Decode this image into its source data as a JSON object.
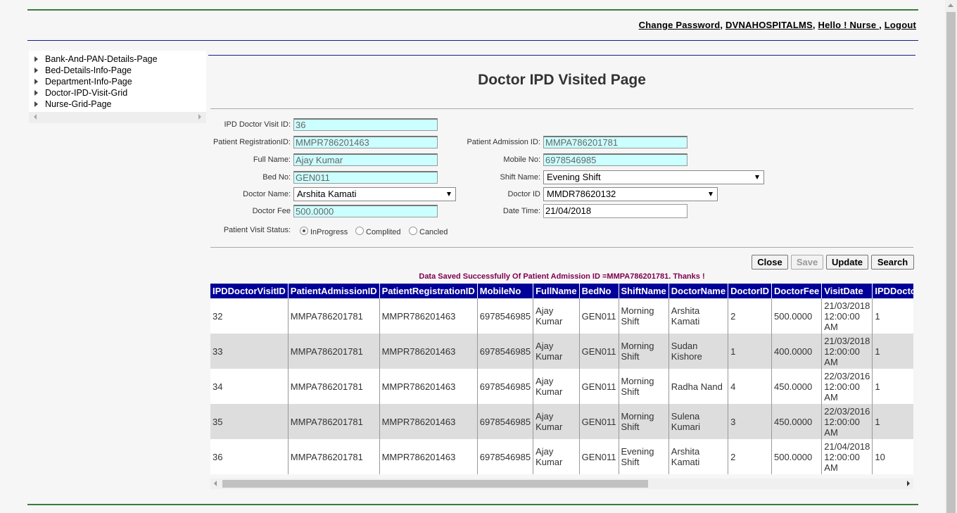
{
  "header": {
    "links": [
      "Change Password",
      "DVNAHOSPITALMS",
      "Hello ! Nurse ",
      "Logout"
    ]
  },
  "tree": {
    "items": [
      "Bank-And-PAN-Details-Page",
      "Bed-Details-Info-Page",
      "Department-Info-Page",
      "Doctor-IPD-Visit-Grid",
      "Nurse-Grid-Page"
    ]
  },
  "page_title": "Doctor IPD Visited Page",
  "form": {
    "ipd_doctor_visit_id": {
      "label": "IPD Doctor Visit ID:",
      "value": "36"
    },
    "patient_registration_id": {
      "label": "Patient RegistrationID:",
      "value": "MMPR786201463"
    },
    "patient_admission_id": {
      "label": "Patient Admission ID:",
      "value": "MMPA786201781"
    },
    "full_name": {
      "label": "Full Name:",
      "value": "Ajay Kumar"
    },
    "mobile_no": {
      "label": "Mobile No:",
      "value": "6978546985"
    },
    "bed_no": {
      "label": "Bed No:",
      "value": "GEN011"
    },
    "shift_name": {
      "label": "Shift Name:",
      "value": "Evening Shift"
    },
    "doctor_name": {
      "label": "Doctor Name:",
      "value": "Arshita Kamati"
    },
    "doctor_id": {
      "label": "Doctor ID",
      "value": "MMDR78620132"
    },
    "doctor_fee": {
      "label": "Doctor Fee",
      "value": "500.0000"
    },
    "date_time": {
      "label": "Date Time:",
      "value": "21/04/2018"
    },
    "visit_status": {
      "label": "Patient Visit Status:",
      "options": [
        "InProgress",
        "Complited",
        "Cancled"
      ],
      "selected": "InProgress"
    }
  },
  "buttons": {
    "close": "Close",
    "save": "Save",
    "update": "Update",
    "search": "Search"
  },
  "message": "Data Saved Successfully Of Patient Admission ID =MMPA786201781. Thanks !",
  "grid": {
    "columns": [
      "IPDDoctorVisitID",
      "PatientAdmissionID",
      "PatientRegistrationID",
      "MobileNo",
      "FullName",
      "BedNo",
      "ShiftName",
      "DoctorName",
      "DoctorID",
      "DoctorFee",
      "VisitDate",
      "IPDDoctorVisitStatus"
    ],
    "rows": [
      [
        "32",
        "MMPA786201781",
        "MMPR786201463",
        "6978546985",
        "Ajay Kumar",
        "GEN011",
        "Morning Shift",
        "Arshita Kamati",
        "2",
        "500.0000",
        "21/03/2018 12:00:00 AM",
        "1"
      ],
      [
        "33",
        "MMPA786201781",
        "MMPR786201463",
        "6978546985",
        "Ajay Kumar",
        "GEN011",
        "Morning Shift",
        "Sudan Kishore",
        "1",
        "400.0000",
        "21/03/2018 12:00:00 AM",
        "1"
      ],
      [
        "34",
        "MMPA786201781",
        "MMPR786201463",
        "6978546985",
        "Ajay Kumar",
        "GEN011",
        "Morning Shift",
        "Radha Nand",
        "4",
        "450.0000",
        "22/03/2016 12:00:00 AM",
        "1"
      ],
      [
        "35",
        "MMPA786201781",
        "MMPR786201463",
        "6978546985",
        "Ajay Kumar",
        "GEN011",
        "Morning Shift",
        "Sulena Kumari",
        "3",
        "450.0000",
        "22/03/2016 12:00:00 AM",
        "1"
      ],
      [
        "36",
        "MMPA786201781",
        "MMPR786201463",
        "6978546985",
        "Ajay Kumar",
        "GEN011",
        "Evening Shift",
        "Arshita Kamati",
        "2",
        "500.0000",
        "21/04/2018 12:00:00 AM",
        "10"
      ]
    ]
  },
  "colors": {
    "grid_header": "#000099",
    "input_bg": "#ccffff",
    "message": "#800050",
    "rule_green": "#3d7a3d",
    "rule_blue": "#1a1a8c"
  }
}
